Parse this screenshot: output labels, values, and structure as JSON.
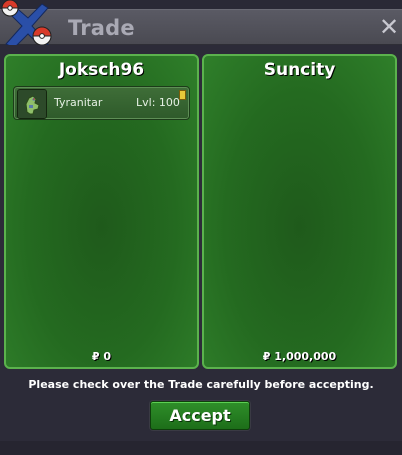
{
  "window": {
    "title": "Trade",
    "close_glyph": "✕",
    "logo_icon": "pokeball-cluster-icon"
  },
  "trade": {
    "left": {
      "name": "Joksch96",
      "money": "₽ 0",
      "items": [
        {
          "name": "Tyranitar",
          "level": "Lvl: 100",
          "icon": "tyranitar-sprite-icon"
        }
      ]
    },
    "right": {
      "name": "Suncity",
      "money": "₽ 1,000,000",
      "items": []
    }
  },
  "footer": {
    "notice": "Please check over the Trade carefully before accepting.",
    "accept_label": "Accept"
  },
  "colors": {
    "panel_green": "#246a20",
    "panel_border": "#5bb24d",
    "titlebar": "#55555e",
    "background": "#2c2b38"
  }
}
